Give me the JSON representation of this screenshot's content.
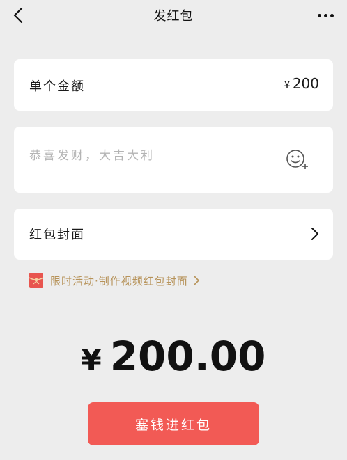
{
  "nav": {
    "title": "发红包",
    "back_icon": "chevron-left-icon",
    "more_icon": "more-dots-icon"
  },
  "amount": {
    "label": "单个金额",
    "currency": "¥",
    "value": "200"
  },
  "wish": {
    "placeholder": "恭喜发财，大吉大利",
    "emoji_icon": "emoji-add-icon"
  },
  "cover": {
    "label": "红包封面",
    "chevron_icon": "chevron-right-icon"
  },
  "promo": {
    "text": "限时活动·制作视频红包封面",
    "icon": "gift-icon",
    "color": "#b7935a"
  },
  "total": {
    "currency": "¥",
    "value": "200.00"
  },
  "submit": {
    "label": "塞钱进红包",
    "color": "#f25a55"
  }
}
